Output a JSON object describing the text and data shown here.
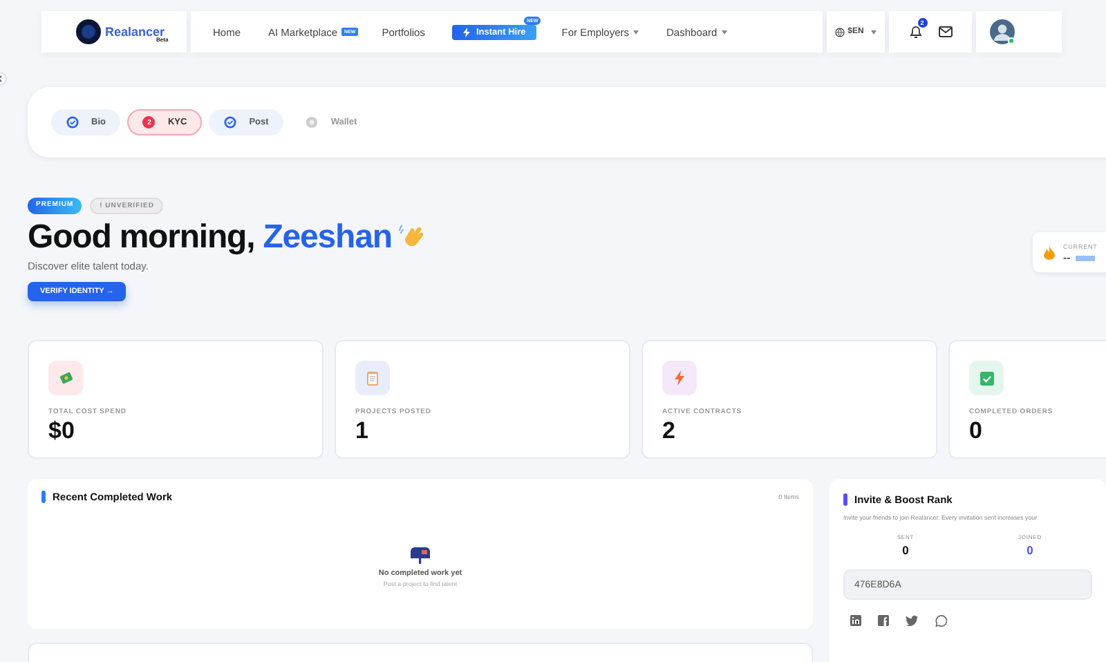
{
  "header": {
    "logo": {
      "name": "Realancer",
      "tag": "Beta"
    },
    "nav": [
      {
        "kind": "link",
        "label": "Home",
        "dropdown": false
      },
      {
        "kind": "link",
        "label": "AI Marketplace",
        "badge": "NEW",
        "dropdown": false
      },
      {
        "kind": "link",
        "label": "Portfolios",
        "dropdown": false
      },
      {
        "kind": "button",
        "label": "Instant Hire",
        "badge": "NEW",
        "dropdown": false
      },
      {
        "kind": "link",
        "label": "For Employers",
        "dropdown": true
      },
      {
        "kind": "link",
        "label": "Dashboard",
        "dropdown": true
      }
    ],
    "language": "$EN",
    "notifications": "2"
  },
  "steps": [
    {
      "label": "Bio",
      "done": true,
      "selected": false
    },
    {
      "label": "KYC",
      "number": "2",
      "done": false,
      "selected": true
    },
    {
      "label": "Post",
      "done": true,
      "selected": false
    },
    {
      "label": "Wallet",
      "done": false,
      "selected": false
    }
  ],
  "hero": {
    "badges": [
      {
        "kind": "premium",
        "label": "PREMIUM"
      },
      {
        "kind": "status",
        "label": "! UNVERIFIED"
      }
    ],
    "greeting": "Good morning, ",
    "name": "Zeeshan",
    "subtitle": "Discover elite talent today.",
    "button": "VERIFY IDENTITY →",
    "rank_card": {
      "label": "CURRENT",
      "value": "--"
    }
  },
  "stats": [
    {
      "label": "TOTAL COST SPEND",
      "value": "$0",
      "color": "#fde8ea"
    },
    {
      "label": "PROJECTS POSTED",
      "value": "1",
      "color": "#e9edfb"
    },
    {
      "label": "ACTIVE CONTRACTS",
      "value": "2",
      "color": "#f3e9f8"
    },
    {
      "label": "COMPLETED ORDERS",
      "value": "0",
      "color": "#e5f6ee"
    }
  ],
  "recent_work": {
    "title": "Recent Completed Work",
    "count": "0 Items",
    "empty_title": "No completed work yet",
    "empty_text": "Post a project to find talent"
  },
  "invite": {
    "title": "Invite & Boost Rank",
    "text": "Invite your friends to join Realancer. Every invitation sent increases your",
    "counters": [
      {
        "label": "SENT",
        "value": "0",
        "selected": false
      },
      {
        "label": "JOINED",
        "value": "0",
        "selected": true
      }
    ],
    "code": "476E8D6A"
  }
}
